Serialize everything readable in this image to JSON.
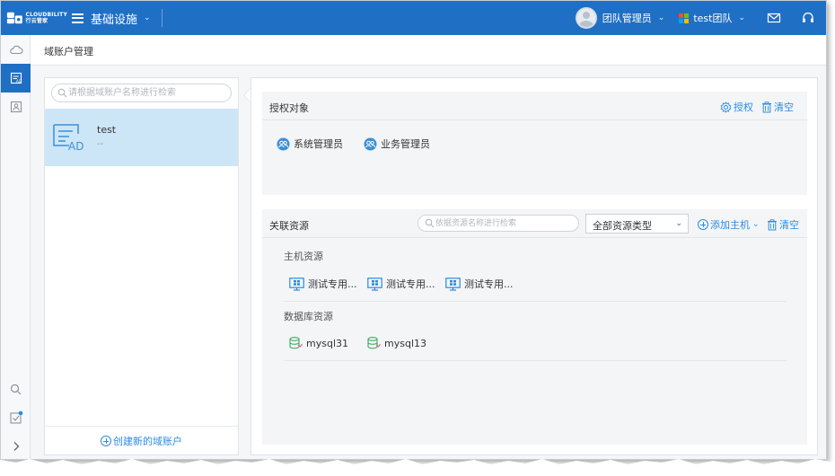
{
  "brand": {
    "logo_text_1": "CLOUDBILITY",
    "logo_text_2": "行云管家"
  },
  "header": {
    "app_title": "基础设施",
    "user_name": "团队管理员",
    "team_name": "test团队",
    "icons": [
      "menu-icon",
      "chevron-down-icon",
      "mail-icon",
      "headset-icon"
    ]
  },
  "colors": {
    "accent": "#1f6fc4",
    "link": "#2a8be0",
    "selected_row": "#cde6f7",
    "db_green": "#3aab5b"
  },
  "breadcrumb": {
    "title": "域账户管理"
  },
  "account_panel": {
    "search_placeholder": "请根据域账户名称进行检索",
    "accounts": [
      {
        "name": "test",
        "sub": "--",
        "badge": "AD"
      }
    ],
    "create_label": "创建新的域账户"
  },
  "auth_card": {
    "title": "授权对象",
    "authorize_label": "授权",
    "clear_label": "清空",
    "subjects": [
      {
        "name": "系统管理员"
      },
      {
        "name": "业务管理员"
      }
    ]
  },
  "resource_card": {
    "title": "关联资源",
    "search_placeholder": "依据资源名称进行检索",
    "type_selected": "全部资源类型",
    "add_host_label": "添加主机",
    "clear_label": "清空",
    "host_section": "主机资源",
    "hosts": [
      {
        "name": "测试专用..."
      },
      {
        "name": "测试专用..."
      },
      {
        "name": "测试专用..."
      }
    ],
    "db_section": "数据库资源",
    "databases": [
      {
        "name": "mysql31"
      },
      {
        "name": "mysql13"
      }
    ]
  }
}
